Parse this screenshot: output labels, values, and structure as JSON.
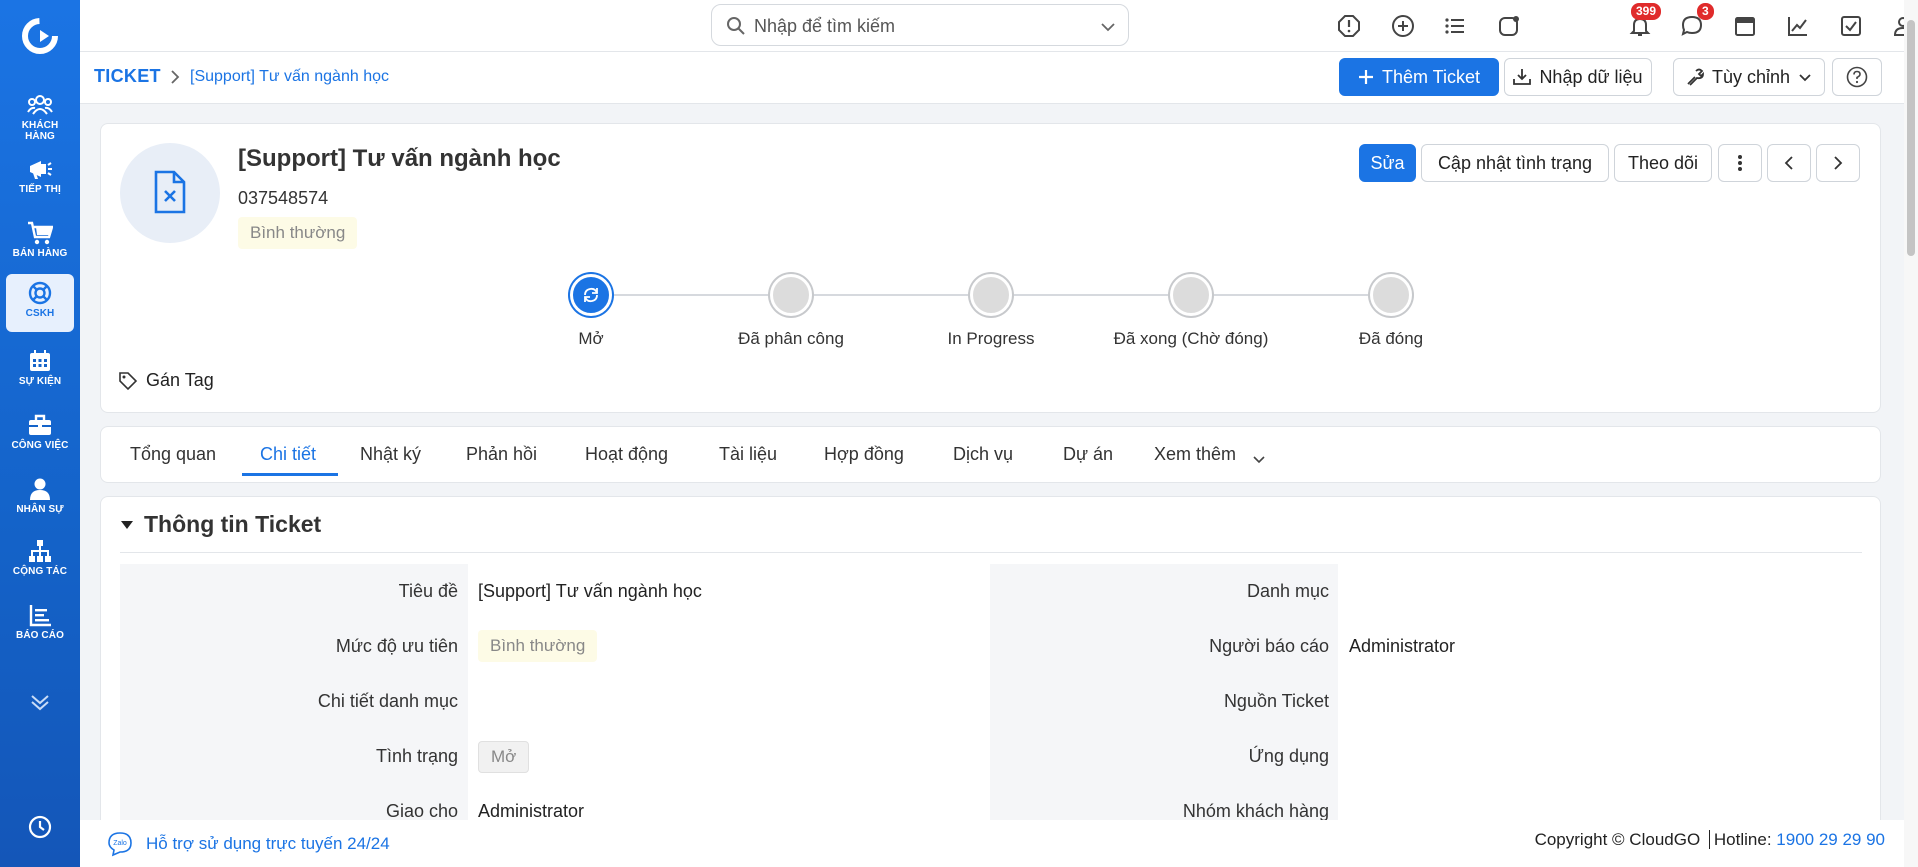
{
  "sidebar": {
    "items": [
      {
        "label": "KHÁCH HÀNG",
        "icon": "customers-icon"
      },
      {
        "label": "TIẾP THỊ",
        "icon": "megaphone-icon"
      },
      {
        "label": "BÁN HÀNG",
        "icon": "cart-icon"
      },
      {
        "label": "CSKH",
        "icon": "lifebuoy-icon"
      },
      {
        "label": "SỰ KIỆN",
        "icon": "calendar-icon"
      },
      {
        "label": "CÔNG VIỆC",
        "icon": "briefcase-icon"
      },
      {
        "label": "NHÂN SỰ",
        "icon": "person-icon"
      },
      {
        "label": "CỘNG TÁC",
        "icon": "org-chart-icon"
      },
      {
        "label": "BÁO CÁO",
        "icon": "report-icon"
      }
    ]
  },
  "topbar": {
    "search_placeholder": "Nhập để tìm kiếm",
    "notifications_count": "399",
    "messages_count": "3"
  },
  "breadcrumb": {
    "root": "TICKET",
    "current": "[Support] Tư vấn ngành học"
  },
  "toolbar": {
    "add_label": "Thêm Ticket",
    "import_label": "Nhập dữ liệu",
    "customize_label": "Tùy chỉnh"
  },
  "record": {
    "title": "[Support] Tư vấn ngành học",
    "phone": "037548574",
    "priority": "Bình thường",
    "edit_label": "Sửa",
    "update_status_label": "Cập nhật tình trạng",
    "follow_label": "Theo dõi",
    "tag_label": "Gán Tag"
  },
  "stepper": {
    "steps": [
      "Mở",
      "Đã phân công",
      "In Progress",
      "Đã xong (Chờ đóng)",
      "Đã đóng"
    ],
    "current_index": 0
  },
  "tabs": [
    "Tổng quan",
    "Chi tiết",
    "Nhật ký",
    "Phản hồi",
    "Hoạt động",
    "Tài liệu",
    "Hợp đồng",
    "Dịch vụ",
    "Dự án",
    "Xem thêm"
  ],
  "active_tab": "Chi tiết",
  "section": {
    "title": "Thông tin Ticket",
    "left_fields": [
      {
        "label": "Tiêu đề",
        "value": "[Support] Tư vấn ngành học"
      },
      {
        "label": "Mức độ ưu tiên",
        "value": "Bình thường"
      },
      {
        "label": "Chi tiết danh mục",
        "value": ""
      },
      {
        "label": "Tình trạng",
        "value": "Mở"
      },
      {
        "label": "Giao cho",
        "value": "Administrator"
      }
    ],
    "right_fields": [
      {
        "label": "Danh mục",
        "value": ""
      },
      {
        "label": "Người báo cáo",
        "value": "Administrator"
      },
      {
        "label": "Nguồn Ticket",
        "value": ""
      },
      {
        "label": "Ứng dụng",
        "value": ""
      },
      {
        "label": "Nhóm khách hàng",
        "value": ""
      }
    ]
  },
  "footer": {
    "support_text": "Hỗ trợ sử dụng trực tuyến 24/24",
    "zalo_label": "Zalo",
    "copyright": "Copyright © CloudGO",
    "hotline_label": "Hotline:",
    "hotline": "1900 29 29 90"
  },
  "colors": {
    "accent": "#1b74e4",
    "sidebar": "#1463c9",
    "badge": "#e02b2b",
    "priority_bg": "#fdfbe6"
  }
}
